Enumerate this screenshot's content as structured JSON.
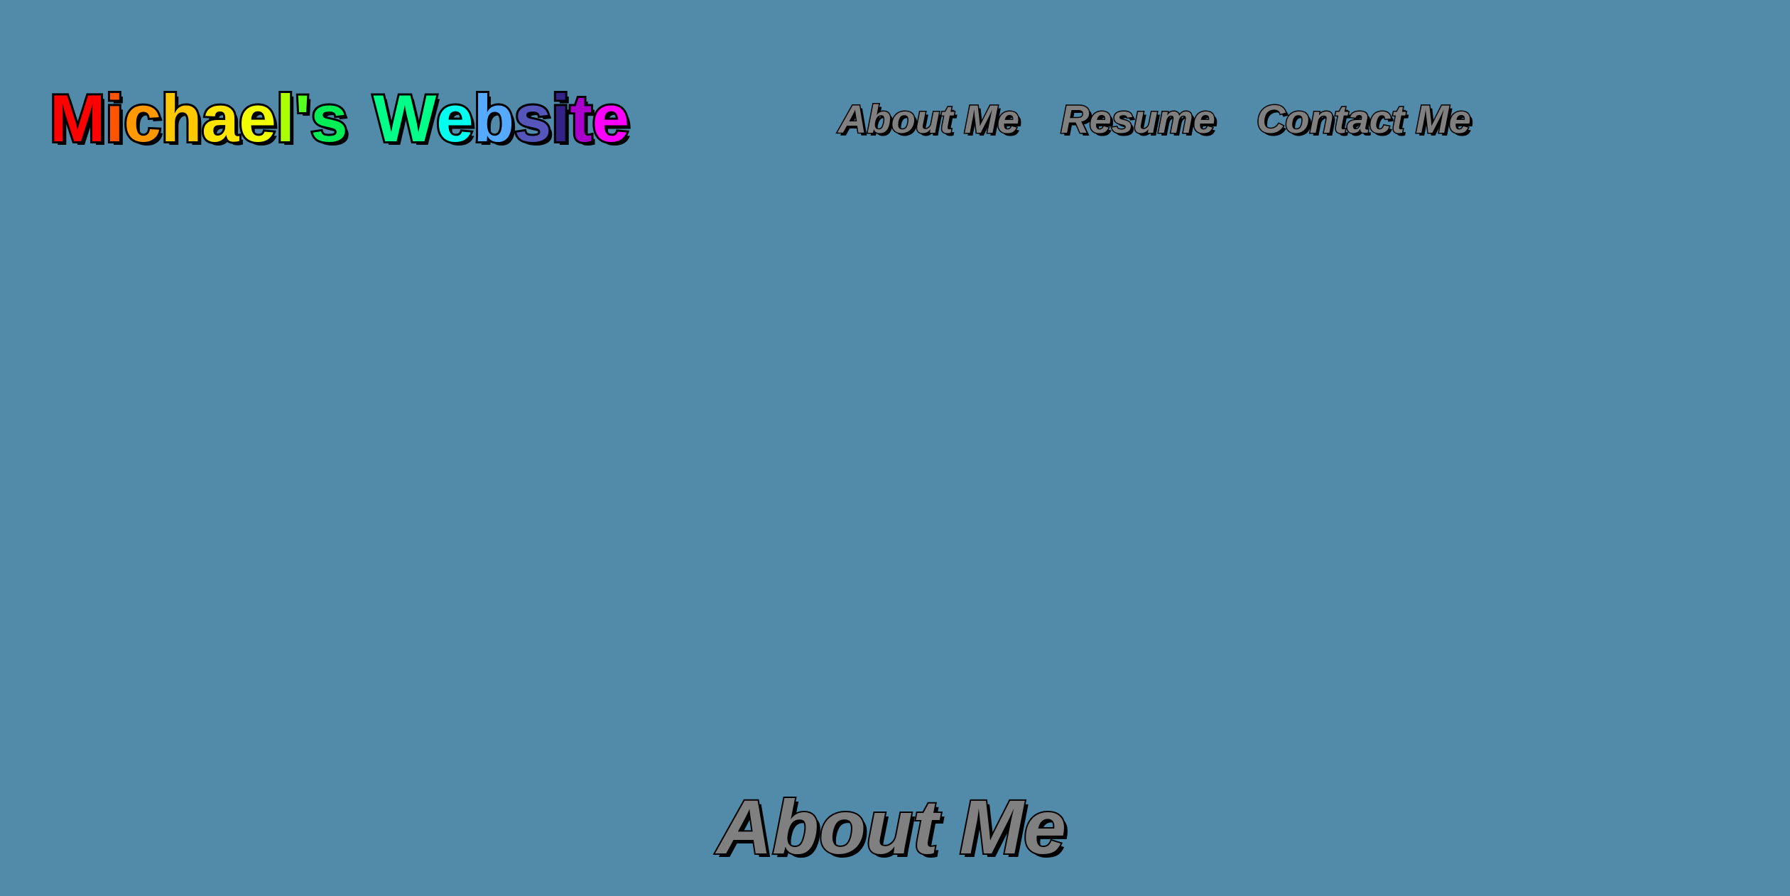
{
  "site": {
    "title_letters": [
      {
        "ch": "M",
        "color": "#ff0000"
      },
      {
        "ch": "i",
        "color": "#ff5500"
      },
      {
        "ch": "c",
        "color": "#ff9900"
      },
      {
        "ch": "h",
        "color": "#ffc800"
      },
      {
        "ch": "a",
        "color": "#ffe600"
      },
      {
        "ch": "e",
        "color": "#f2ff00"
      },
      {
        "ch": "l",
        "color": "#aaff00"
      },
      {
        "ch": "'",
        "color": "#55ff22"
      },
      {
        "ch": "s",
        "color": "#00ee55"
      },
      {
        "ch": " ",
        "color": ""
      },
      {
        "ch": "W",
        "color": "#00ff88"
      },
      {
        "ch": "e",
        "color": "#00ffee"
      },
      {
        "ch": "b",
        "color": "#55aaff"
      },
      {
        "ch": "s",
        "color": "#5555bb"
      },
      {
        "ch": "i",
        "color": "#332288"
      },
      {
        "ch": "t",
        "color": "#aa00cc"
      },
      {
        "ch": "e",
        "color": "#ff00ff"
      }
    ]
  },
  "nav": {
    "items": [
      {
        "label": "About Me"
      },
      {
        "label": "Resume"
      },
      {
        "label": "Contact Me"
      }
    ]
  },
  "main": {
    "section_title": "About Me"
  },
  "colors": {
    "background": "#528baa",
    "nav_text": "#808080",
    "outline": "#000000"
  }
}
